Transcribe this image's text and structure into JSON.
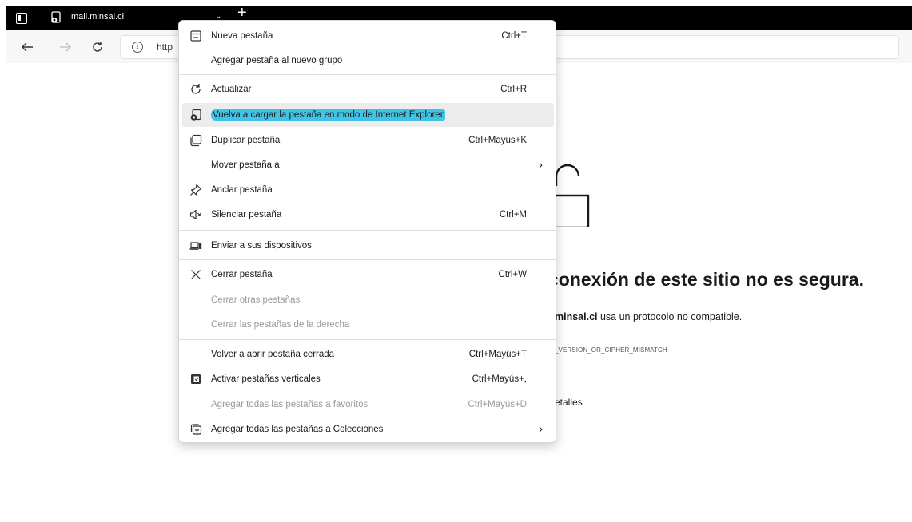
{
  "tab": {
    "title": "mail.minsal.cl"
  },
  "address_bar": {
    "visible_text": "http"
  },
  "page": {
    "error_title": "conexión de este sitio no es segura.",
    "error_desc_bold": "minsal.cl",
    "error_desc_rest": " usa un protocolo no compatible.",
    "error_code": "_VERSION_OR_CIPHER_MISMATCH",
    "details_label": "etalles"
  },
  "menu": {
    "items": [
      {
        "icon": "new-tab-icon",
        "label": "Nueva pestaña",
        "shortcut": "Ctrl+T"
      },
      {
        "icon": "",
        "label": "Agregar pestaña al nuevo grupo",
        "shortcut": ""
      },
      {
        "icon": "refresh-icon",
        "label": "Actualizar",
        "shortcut": "Ctrl+R"
      },
      {
        "icon": "ie-mode-icon",
        "label": "Vuelva a cargar la pestaña en modo de Internet Explorer",
        "shortcut": ""
      },
      {
        "icon": "duplicate-icon",
        "label": "Duplicar pestaña",
        "shortcut": "Ctrl+Mayús+K"
      },
      {
        "icon": "",
        "label": "Mover pestaña a",
        "shortcut": ""
      },
      {
        "icon": "pin-icon",
        "label": "Anclar pestaña",
        "shortcut": ""
      },
      {
        "icon": "mute-icon",
        "label": "Silenciar pestaña",
        "shortcut": "Ctrl+M"
      },
      {
        "icon": "devices-icon",
        "label": "Enviar a sus dispositivos",
        "shortcut": ""
      },
      {
        "icon": "close-icon",
        "label": "Cerrar pestaña",
        "shortcut": "Ctrl+W"
      },
      {
        "icon": "",
        "label": "Cerrar otras pestañas",
        "shortcut": ""
      },
      {
        "icon": "",
        "label": "Cerrar las pestañas de la derecha",
        "shortcut": ""
      },
      {
        "icon": "",
        "label": "Volver a abrir pestaña cerrada",
        "shortcut": "Ctrl+Mayús+T"
      },
      {
        "icon": "vertical-tabs-icon",
        "label": "Activar pestañas verticales",
        "shortcut": "Ctrl+Mayús+,"
      },
      {
        "icon": "",
        "label": "Agregar todas las pestañas a favoritos",
        "shortcut": "Ctrl+Mayús+D"
      },
      {
        "icon": "collections-icon",
        "label": "Agregar todas las pestañas a Colecciones",
        "shortcut": ""
      }
    ],
    "highlight_color": "#3fc4e8"
  }
}
